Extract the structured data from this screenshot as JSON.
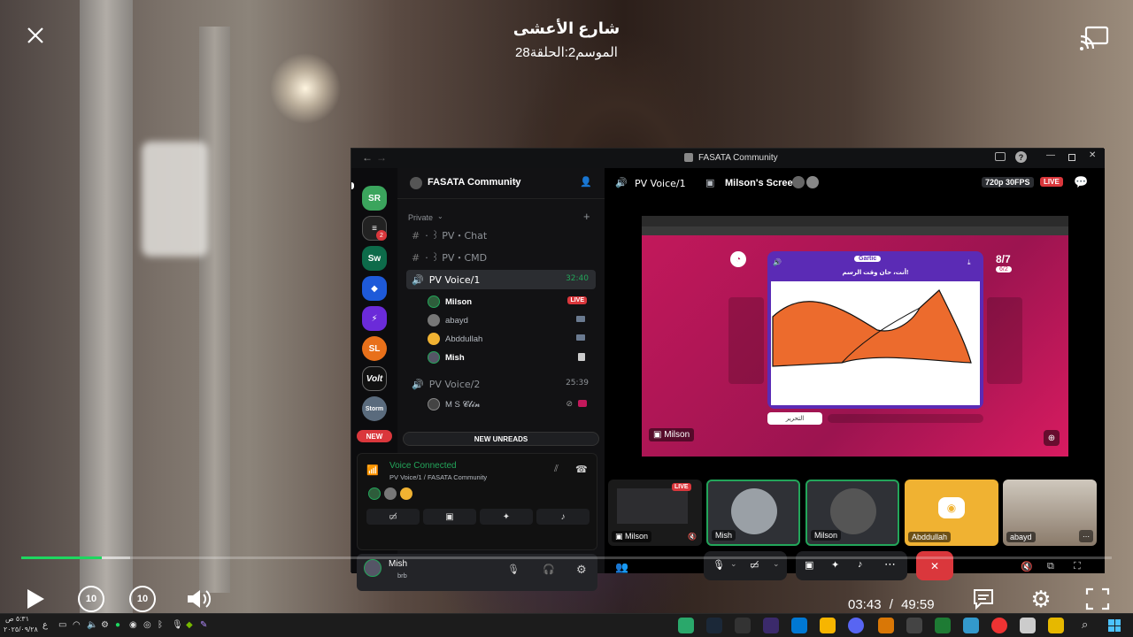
{
  "video": {
    "title": "شارع الأعشى",
    "subtitle": "الموسم2:الحلقة28",
    "current_time": "03:43",
    "separator": "/",
    "duration": "49:59",
    "progress": 0.074,
    "buffered": 0.1
  },
  "discord": {
    "window_title": "FASATA Community",
    "server_name": "FASATA Community",
    "category": "Private",
    "channels": [
      {
        "name": "· ꒱ PV・Chat",
        "type": "text"
      },
      {
        "name": "· ꒱ PV・CMD",
        "type": "text"
      },
      {
        "name": "PV Voice/1",
        "type": "voice",
        "timer": "32:40",
        "active": true
      },
      {
        "name": "PV Voice/2",
        "type": "voice",
        "timer": "25:39",
        "active": false
      }
    ],
    "voice1_users": [
      {
        "name": "Milson",
        "badge": "LIVE"
      },
      {
        "name": "abayd"
      },
      {
        "name": "Abddullah"
      },
      {
        "name": "Mish"
      }
    ],
    "voice2_users": [
      {
        "name": "M S 𝓒𝓵𝓲𝓷"
      }
    ],
    "new_badge": "NEW",
    "new_unreads": "NEW UNREADS",
    "voice_connected": "Voice Connected",
    "voice_location": "PV Voice/1 / FASATA Community",
    "user_name": "Mish",
    "user_status": "brb",
    "channel_header": "PV Voice/1",
    "screen_header": "Milson's Screen",
    "quality": "720p 30FPS",
    "live": "LIVE",
    "stream_owner": "Milson",
    "game": {
      "round": "8/7",
      "round_sub": "6/2",
      "prompt": "أنت، حان وقت الرسم!",
      "logo": "Gartic",
      "edit_button": "التحرير"
    },
    "tiles": [
      {
        "name": "Milson",
        "live": "LIVE"
      },
      {
        "name": "Mish"
      },
      {
        "name": "Milson"
      },
      {
        "name": "Abddullah"
      },
      {
        "name": "abayd"
      }
    ]
  },
  "taskbar": {
    "time": "٥:٣١ ص",
    "date": "٢٠٢٥/٠٩/٢٨",
    "lang": "ع"
  },
  "colors": {
    "discord_green": "#23a55a",
    "discord_red": "#da373c",
    "blurple": "#5865f2",
    "game_magenta": "#c2185b",
    "drawing_orange": "#ec6b2d",
    "progress_green": "#1ed760"
  }
}
